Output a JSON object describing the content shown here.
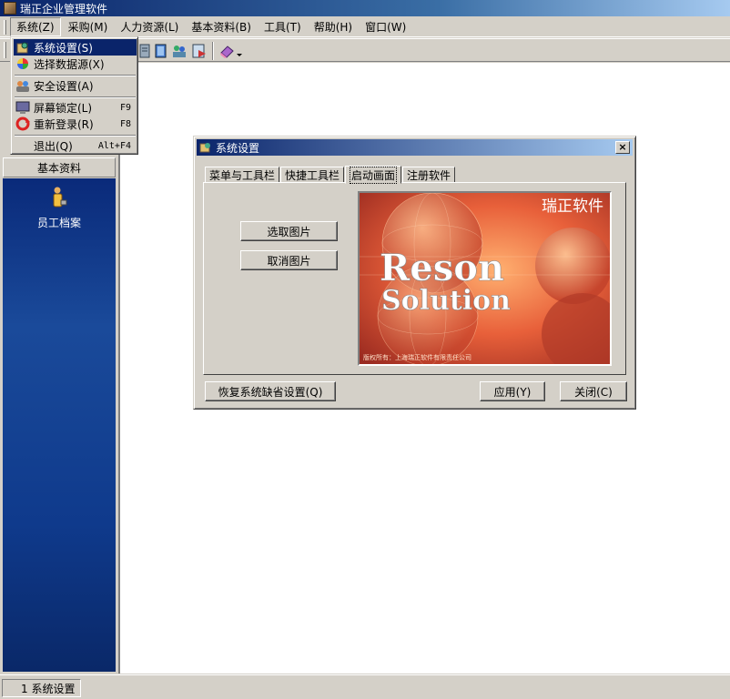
{
  "window": {
    "title": "瑞正企业管理软件"
  },
  "menubar": {
    "items": [
      {
        "label": "系统(Z)"
      },
      {
        "label": "采购(M)"
      },
      {
        "label": "人力资源(L)"
      },
      {
        "label": "基本资料(B)"
      },
      {
        "label": "工具(T)"
      },
      {
        "label": "帮助(H)"
      },
      {
        "label": "窗口(W)"
      }
    ]
  },
  "system_menu": {
    "items": [
      {
        "label": "系统设置(S)",
        "shortcut": "",
        "icon": "settings-icon"
      },
      {
        "label": "选择数据源(X)",
        "shortcut": "",
        "icon": "datasource-icon"
      },
      {
        "label": "安全设置(A)",
        "shortcut": "",
        "icon": "users-icon"
      },
      {
        "label": "屏幕锁定(L)",
        "shortcut": "F9",
        "icon": "lock-screen-icon"
      },
      {
        "label": "重新登录(R)",
        "shortcut": "F8",
        "icon": "relogin-icon"
      },
      {
        "label": "退出(Q)",
        "shortcut": "Alt+F4",
        "icon": ""
      }
    ]
  },
  "left_panel": {
    "header": "基本资料",
    "items": [
      {
        "label": "员工档案",
        "icon": "employee-icon"
      }
    ]
  },
  "dialog": {
    "title": "系统设置",
    "tabs": [
      {
        "label": "菜单与工具栏"
      },
      {
        "label": "快捷工具栏"
      },
      {
        "label": "启动画面"
      },
      {
        "label": "注册软件"
      }
    ],
    "active_tab": "启动画面",
    "select_image_button": "选取图片",
    "cancel_image_button": "取消图片",
    "splash": {
      "brand_cn": "瑞正软件",
      "word1": "Reson",
      "word2": "Solution",
      "copyright": "版权所有：上海瑞正软件有限责任公司"
    },
    "restore_defaults_button": "恢复系统缺省设置(Q)",
    "apply_button": "应用(Y)",
    "close_button": "关闭(C)"
  },
  "statusbar": {
    "task_label": "1 系统设置"
  },
  "colors": {
    "title_blue": "#0a246a",
    "panel_blue": "#1a4a9a",
    "face": "#d4d0c8"
  }
}
